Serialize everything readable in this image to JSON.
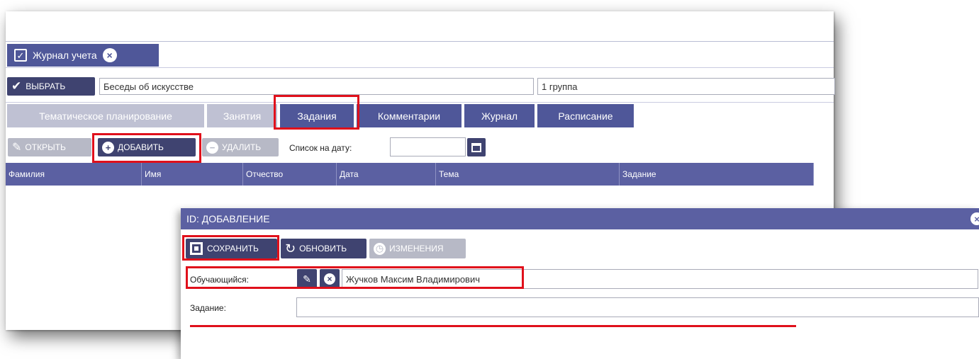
{
  "doc_tab": {
    "label": "Журнал учета"
  },
  "select_bar": {
    "select_label": "ВЫБРАТЬ",
    "course_value": "Беседы об искусстве",
    "group_value": "1 группа"
  },
  "tabs": [
    {
      "label": "Тематическое планирование"
    },
    {
      "label": "Занятия"
    },
    {
      "label": "Задания"
    },
    {
      "label": "Комментарии"
    },
    {
      "label": "Журнал"
    },
    {
      "label": "Расписание"
    }
  ],
  "toolbar": {
    "open_label": "ОТКРЫТЬ",
    "add_label": "ДОБАВИТЬ",
    "delete_label": "УДАЛИТЬ",
    "date_label": "Список на дату:",
    "date_value": ""
  },
  "grid": {
    "columns": [
      "Фамилия",
      "Имя",
      "Отчество",
      "Дата",
      "Тема",
      "Задание"
    ]
  },
  "dialog": {
    "title": "ID: ДОБАВЛЕНИЕ",
    "save_label": "СОХРАНИТЬ",
    "refresh_label": "ОБНОВИТЬ",
    "changes_label": "ИЗМЕНЕНИЯ",
    "student_label": "Обучающийся:",
    "student_value": "Жучков Максим Владимирович",
    "task_label": "Задание:",
    "task_value": ""
  },
  "colors": {
    "accent": "#4f5799",
    "dark_button": "#3f4370",
    "inactive_tab": "#bfc1d3",
    "highlight": "#e0101b"
  }
}
